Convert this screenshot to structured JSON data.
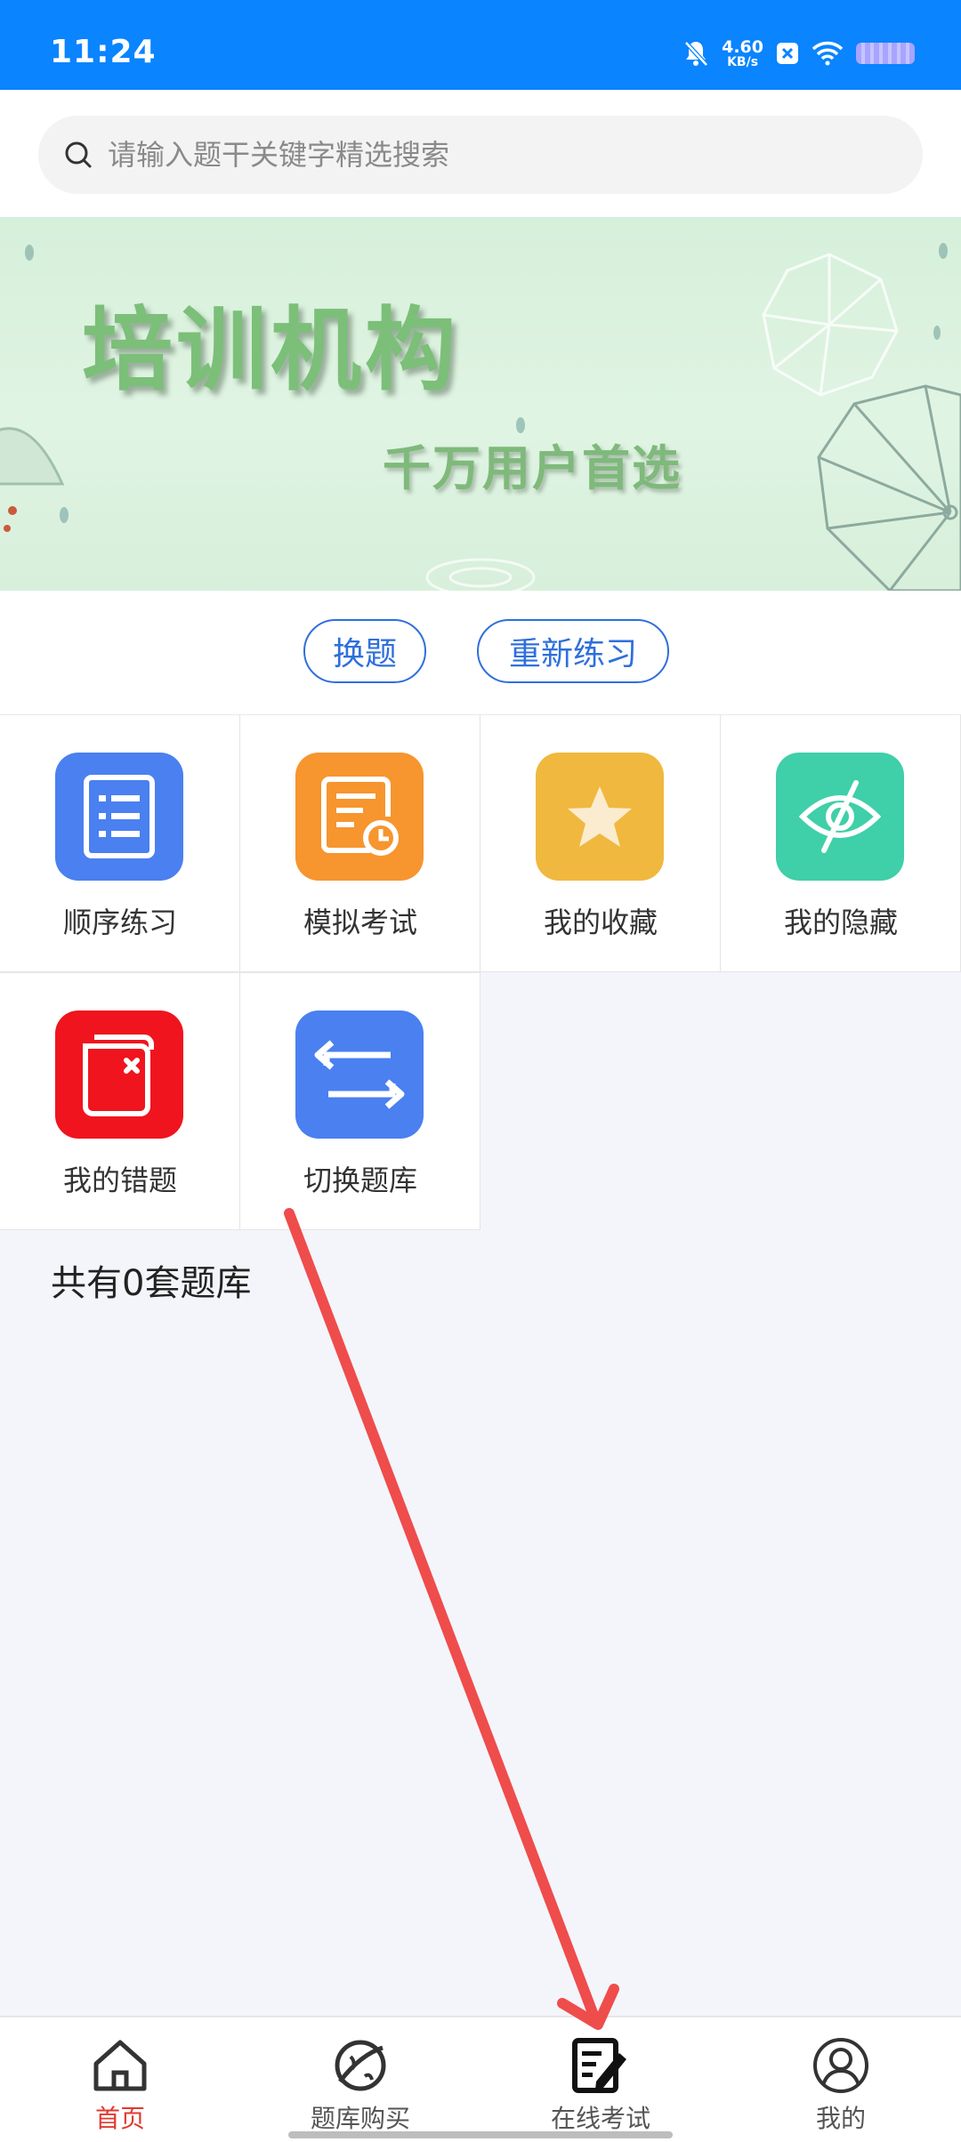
{
  "status_bar": {
    "time": "11:24",
    "speed_value": "4.60",
    "speed_unit": "KB/s"
  },
  "search": {
    "placeholder": "请输入题干关键字精选搜索"
  },
  "banner": {
    "title": "培训机构",
    "subtitle": "千万用户首选"
  },
  "actions": {
    "change": "换题",
    "restart": "重新练习"
  },
  "grid": {
    "items": [
      {
        "label": "顺序练习",
        "icon": "list-icon",
        "color": "#4a80f0"
      },
      {
        "label": "模拟考试",
        "icon": "exam-clock-icon",
        "color": "#f7952e"
      },
      {
        "label": "我的收藏",
        "icon": "star-icon",
        "color": "#f0b83e"
      },
      {
        "label": "我的隐藏",
        "icon": "eye-off-icon",
        "color": "#3fcfa9"
      },
      {
        "label": "我的错题",
        "icon": "wrong-question-icon",
        "color": "#f0141e"
      },
      {
        "label": "切换题库",
        "icon": "switch-icon",
        "color": "#4a80f0"
      }
    ]
  },
  "bank_count": "共有0套题库",
  "bottom_nav": {
    "items": [
      {
        "label": "首页",
        "icon": "home-icon",
        "active": true
      },
      {
        "label": "题库购买",
        "icon": "planet-icon",
        "active": false
      },
      {
        "label": "在线考试",
        "icon": "edit-paper-icon",
        "active": false
      },
      {
        "label": "我的",
        "icon": "user-icon",
        "active": false
      }
    ],
    "active_color": "#e03a2f"
  },
  "colors": {
    "primary": "#0a84ff",
    "accent_blue": "#2f6fdc",
    "annotation_arrow": "#ef4c4c"
  }
}
